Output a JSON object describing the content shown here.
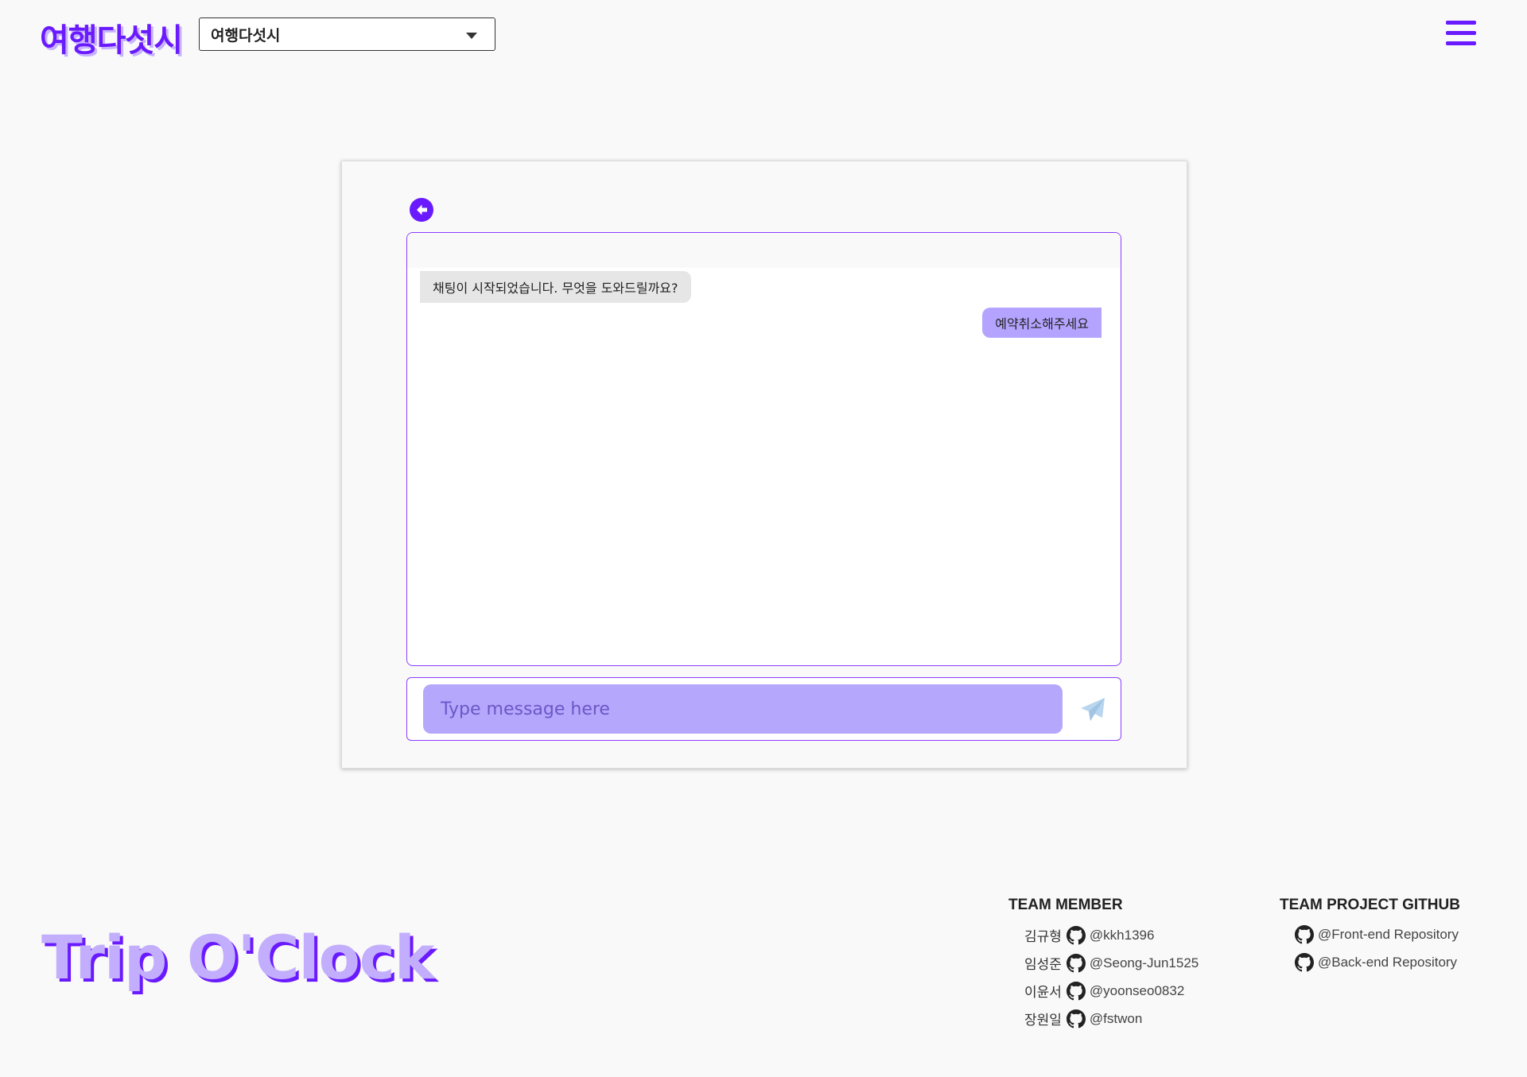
{
  "header": {
    "logo_text": "여행다섯시",
    "select_value": "여행다섯시",
    "menu_icon": "hamburger-menu-icon",
    "brand_color": "#6a1aff"
  },
  "chat": {
    "back_icon": "back-arrow-icon",
    "messages": [
      {
        "sender": "bot",
        "text": "채팅이 시작되었습니다. 무엇을 도와드릴까요?"
      },
      {
        "sender": "user",
        "text": "예약취소해주세요"
      }
    ],
    "input_placeholder": "Type message here",
    "send_icon": "send-icon",
    "bot_bubble_color": "#e6e6e6",
    "user_bubble_color": "#b5a4ff",
    "border_color": "#8b3dff"
  },
  "footer": {
    "brand_text": "Trip O'Clock",
    "team_member_heading": "TEAM MEMBER",
    "members": [
      {
        "name": "김규형",
        "handle": "@kkh1396"
      },
      {
        "name": "임성준",
        "handle": "@Seong-Jun1525"
      },
      {
        "name": "이윤서",
        "handle": "@yoonseo0832"
      },
      {
        "name": "장원일",
        "handle": "@fstwon"
      }
    ],
    "github_heading": "TEAM PROJECT GITHUB",
    "repos": [
      {
        "label": "@Front-end Repository"
      },
      {
        "label": "@Back-end Repository"
      }
    ],
    "github_icon": "github-icon"
  }
}
